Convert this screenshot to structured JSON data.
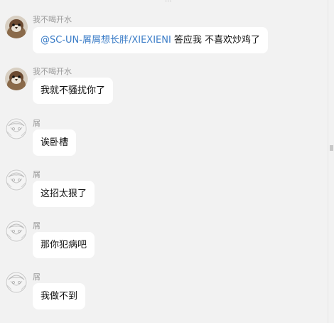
{
  "top_fragment": "...",
  "messages": [
    {
      "sender": "我不喝开水",
      "avatar_icon": "sparrow-avatar-icon",
      "mention": "@SC-UN-屑屑想长胖/XIEXIENI",
      "text": " 答应我 不喜欢炒鸡了"
    },
    {
      "sender": "我不喝开水",
      "avatar_icon": "sparrow-avatar-icon",
      "text": "我就不骚扰你了"
    },
    {
      "sender": "屑",
      "avatar_icon": "anime-sketch-avatar-icon",
      "text": "诶卧槽"
    },
    {
      "sender": "屑",
      "avatar_icon": "anime-sketch-avatar-icon",
      "text": "这招太狠了"
    },
    {
      "sender": "屑",
      "avatar_icon": "anime-sketch-avatar-icon",
      "text": "那你犯病吧"
    },
    {
      "sender": "屑",
      "avatar_icon": "anime-sketch-avatar-icon",
      "text": "我做不到"
    }
  ]
}
